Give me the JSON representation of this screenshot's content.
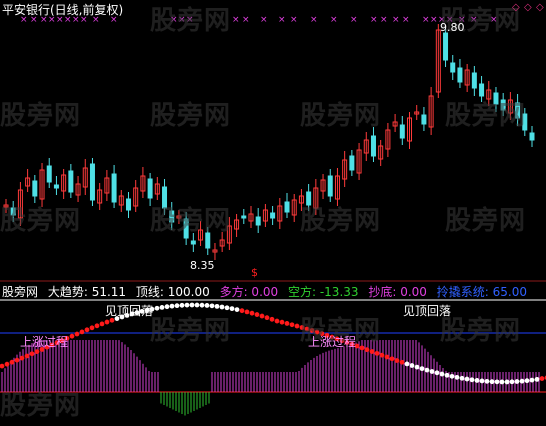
{
  "title": "平安银行(日线,前复权)",
  "watermark": "股旁网",
  "price_high_label": "9.80",
  "price_low_label": "8.35",
  "signal_marker": "$",
  "indicator": {
    "name": "股旁网",
    "label_main": "大趋势: 51.11",
    "label_top": "顶线: 100.00",
    "label_long": "多方: 0.00",
    "label_short": "空方: -13.33",
    "label_bottom": "抄底: 0.00",
    "label_sys": "拎撬系统: 65.00"
  },
  "annotations": {
    "top1": "见顶回落",
    "top2": "见顶回落",
    "rise1": "上涨过程",
    "rise2": "上涨过程"
  },
  "colors": {
    "up": "#ff3b3b",
    "down": "#4fe0e6",
    "trend_up": "#ff1a1a",
    "trend_down": "#ffffff",
    "hist_pos": "#d23fd2",
    "hist_neg": "#2fbf2f",
    "line_blue": "#2040ff",
    "marker": "#e040e0"
  }
}
